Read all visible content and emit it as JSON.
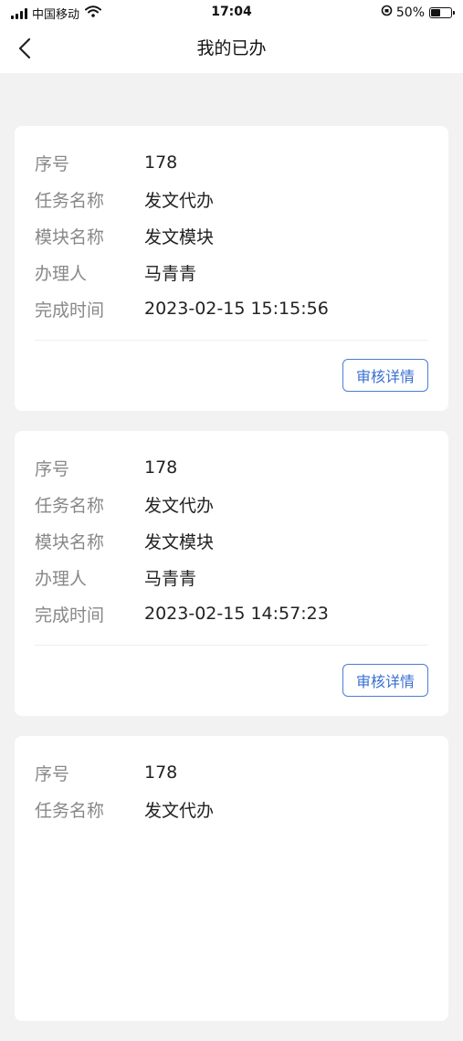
{
  "status_bar": {
    "carrier": "中国移动",
    "time": "17:04",
    "battery": "50%",
    "battery_level": 0.5
  },
  "nav": {
    "title": "我的已办",
    "back_icon": "chevron-left-icon"
  },
  "labels": {
    "seq": "序号",
    "task_name": "任务名称",
    "module_name": "模块名称",
    "handler": "办理人",
    "completed_time": "完成时间",
    "detail_button": "审核详情"
  },
  "records": [
    {
      "seq": "178",
      "task_name": "发文代办",
      "module_name": "发文模块",
      "handler": "马青青",
      "completed_time": "2023-02-15 15:15:56"
    },
    {
      "seq": "178",
      "task_name": "发文代办",
      "module_name": "发文模块",
      "handler": "马青青",
      "completed_time": "2023-02-15 14:57:23"
    },
    {
      "seq": "178",
      "task_name": "发文代办"
    }
  ],
  "colors": {
    "accent": "#3a6fd0",
    "background": "#f2f2f2"
  }
}
